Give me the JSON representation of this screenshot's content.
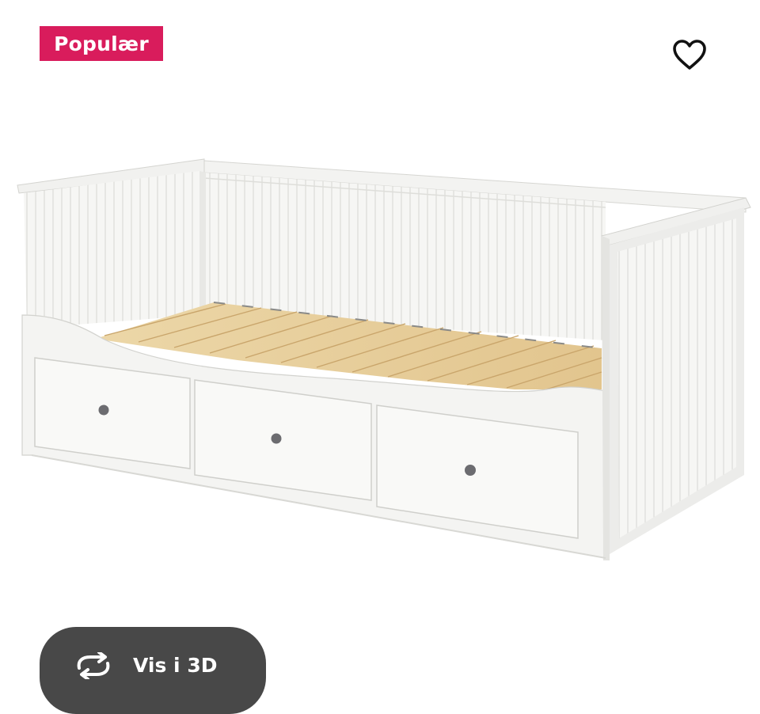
{
  "badge": {
    "label": "Populær",
    "color": "#d91c5c"
  },
  "favorite": {
    "icon": "heart-icon"
  },
  "product": {
    "image": "white-daybed-with-three-drawers"
  },
  "view3d": {
    "label": "Vis i 3D",
    "icon": "rotate-3d-icon"
  }
}
